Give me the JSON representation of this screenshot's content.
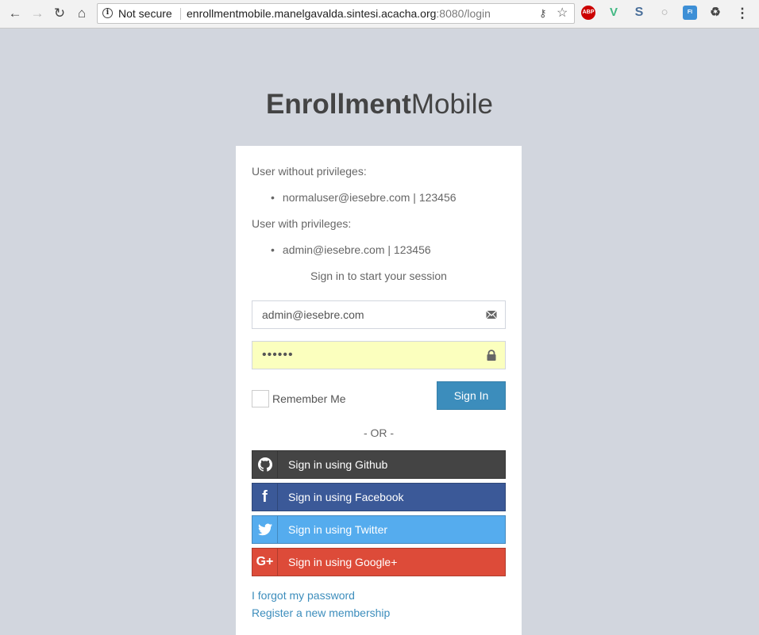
{
  "browser": {
    "security_label": "Not secure",
    "url_host": "enrollmentmobile.manelgavalda.sintesi.acacha.org",
    "url_rest": ":8080/login",
    "extensions": [
      "ABP",
      "V",
      "S",
      "○",
      "FI",
      "♻"
    ]
  },
  "logo": {
    "bold": "Enrollment",
    "light": "Mobile"
  },
  "info": {
    "no_priv_label": "User without privileges:",
    "no_priv_cred": "normaluser@iesebre.com | 123456",
    "priv_label": "User with privileges:",
    "priv_cred": "admin@iesebre.com | 123456"
  },
  "form": {
    "message": "Sign in to start your session",
    "email_value": "admin@iesebre.com",
    "password_value": "••••••",
    "remember_label": "Remember Me",
    "signin_label": "Sign In"
  },
  "or_label": "- OR -",
  "social": {
    "github": "Sign in using Github",
    "facebook": "Sign in using Facebook",
    "twitter": "Sign in using Twitter",
    "google": "Sign in using Google+"
  },
  "links": {
    "forgot": "I forgot my password",
    "register": "Register a new membership"
  },
  "colors": {
    "background": "#d2d6de",
    "primary": "#3c8dbc",
    "github": "#444444",
    "facebook": "#3b5998",
    "twitter": "#55acee",
    "google": "#dd4b39",
    "autofill": "#fbffbe"
  }
}
